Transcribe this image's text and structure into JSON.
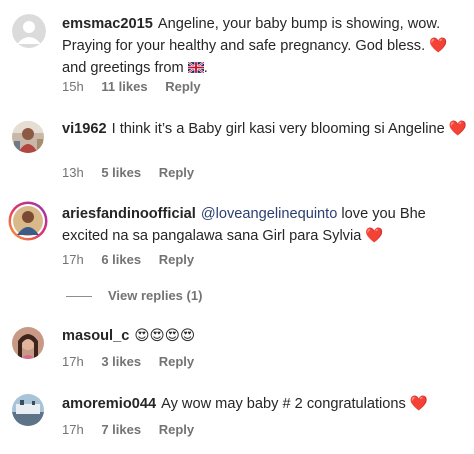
{
  "comments": [
    {
      "username": "emsmac2015",
      "text": "Angeline, your baby bump is showing, wow. Praying for your healthy and safe pregnancy. God bless.",
      "emoji_heart": "❤️",
      "text_after": "and greetings from",
      "flag_icon": "uk-flag-icon",
      "trailing": ".",
      "time": "15h",
      "likes": "11 likes",
      "reply": "Reply"
    },
    {
      "username": "vi1962",
      "text": "I think it’s a Baby girl kasi very blooming si Angeline",
      "emoji_heart": "❤️",
      "time": "13h",
      "likes": "5 likes",
      "reply": "Reply"
    },
    {
      "username": "ariesfandinoofficial",
      "mention": "@loveangelinequinto",
      "text": "love you Bhe excited na sa pangalawa sana Girl para Sylvia",
      "emoji_heart": "❤️",
      "time": "17h",
      "likes": "6 likes",
      "reply": "Reply",
      "view_replies": "View replies (1)"
    },
    {
      "username": "masoul_c",
      "emojis": "😍😍😍😍",
      "time": "17h",
      "likes": "3 likes",
      "reply": "Reply"
    },
    {
      "username": "amoremio044",
      "text": "Ay wow may baby # 2 congratulations",
      "emoji_heart": "❤️",
      "time": "17h",
      "likes": "7 likes",
      "reply": "Reply"
    }
  ],
  "colors": {
    "text": "#262626",
    "meta": "#737373",
    "mention": "#2b3f72",
    "heart": "#e0203a"
  }
}
